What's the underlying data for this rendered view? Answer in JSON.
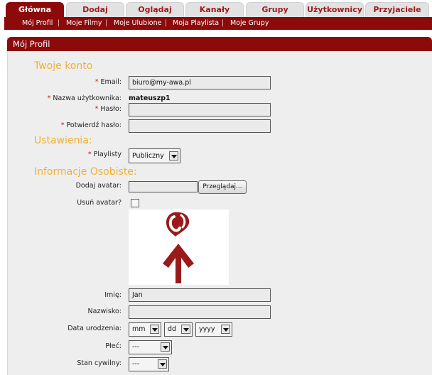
{
  "tabs": [
    {
      "label": "Główna",
      "active": true
    },
    {
      "label": "Dodaj"
    },
    {
      "label": "Oglądaj"
    },
    {
      "label": "Kanały"
    },
    {
      "label": "Grupy"
    },
    {
      "label": "Użytkownicy"
    },
    {
      "label": "Przyjaciele"
    }
  ],
  "subnav": [
    "Mój Profil",
    "Moje Filmy",
    "Moje Ulubione",
    "Moja Playlista",
    "Moje Grupy"
  ],
  "subnav_separator": "|",
  "panel_title": "Mój Profil",
  "sections": {
    "account": "Twoje konto",
    "settings": "Ustawienia:",
    "personal": "Informacje Osobiste:"
  },
  "required_mark": "*",
  "form": {
    "email_label": "Email:",
    "email_value": "biuro@my-awa.pl",
    "username_label": "Nazwa użytkownika:",
    "username_value": "mateuszp1",
    "password_label": "Hasło:",
    "confirm_password_label": "Potwierdź hasło:",
    "playlists_label": "Playlisty",
    "playlists_value": "Publiczny",
    "add_avatar_label": "Dodaj avatar:",
    "browse_button": "Przeglądaj...",
    "remove_avatar_label": "Usuń avatar?",
    "first_name_label": "Imię:",
    "first_name_value": "Jan",
    "last_name_label": "Nazwisko:",
    "last_name_value": "",
    "birth_date_label": "Data urodzenia:",
    "birth_month": "mm",
    "birth_day": "dd",
    "birth_year": "yyyy",
    "gender_label": "Płeć:",
    "gender_value": "---",
    "marital_label": "Stan cywilny:",
    "marital_value": "---"
  },
  "colors": {
    "brand": "#8d0a0a",
    "section_heading": "#f2b030",
    "required": "#cc1010"
  }
}
